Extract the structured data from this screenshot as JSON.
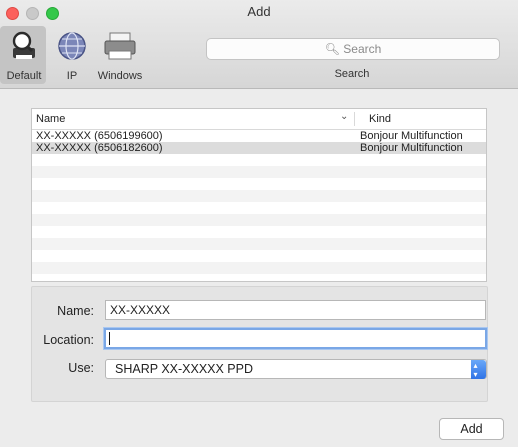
{
  "window": {
    "title": "Add"
  },
  "toolbar": {
    "tools": [
      {
        "label": "Default",
        "icon": "default-printer-icon",
        "selected": true
      },
      {
        "label": "IP",
        "icon": "globe-icon",
        "selected": false
      },
      {
        "label": "Windows",
        "icon": "windows-printer-icon",
        "selected": false
      }
    ],
    "search": {
      "placeholder": "Search",
      "label": "Search"
    }
  },
  "printer_list": {
    "columns": {
      "name": "Name",
      "kind": "Kind"
    },
    "rows": [
      {
        "name": "XX-XXXXX (6506199600)",
        "kind": "Bonjour Multifunction"
      },
      {
        "name": "XX-XXXXX (6506182600)",
        "kind": "Bonjour Multifunction"
      }
    ]
  },
  "details": {
    "name_label": "Name:",
    "name_value": "XX-XXXXX",
    "location_label": "Location:",
    "location_value": "",
    "use_label": "Use:",
    "use_value": "SHARP XX-XXXXX PPD"
  },
  "actions": {
    "add_label": "Add"
  },
  "colors": {
    "close": "#fc605c",
    "minimize": "#c9c9c9",
    "maximize": "#34c84a",
    "accent": "#2f73e6"
  }
}
